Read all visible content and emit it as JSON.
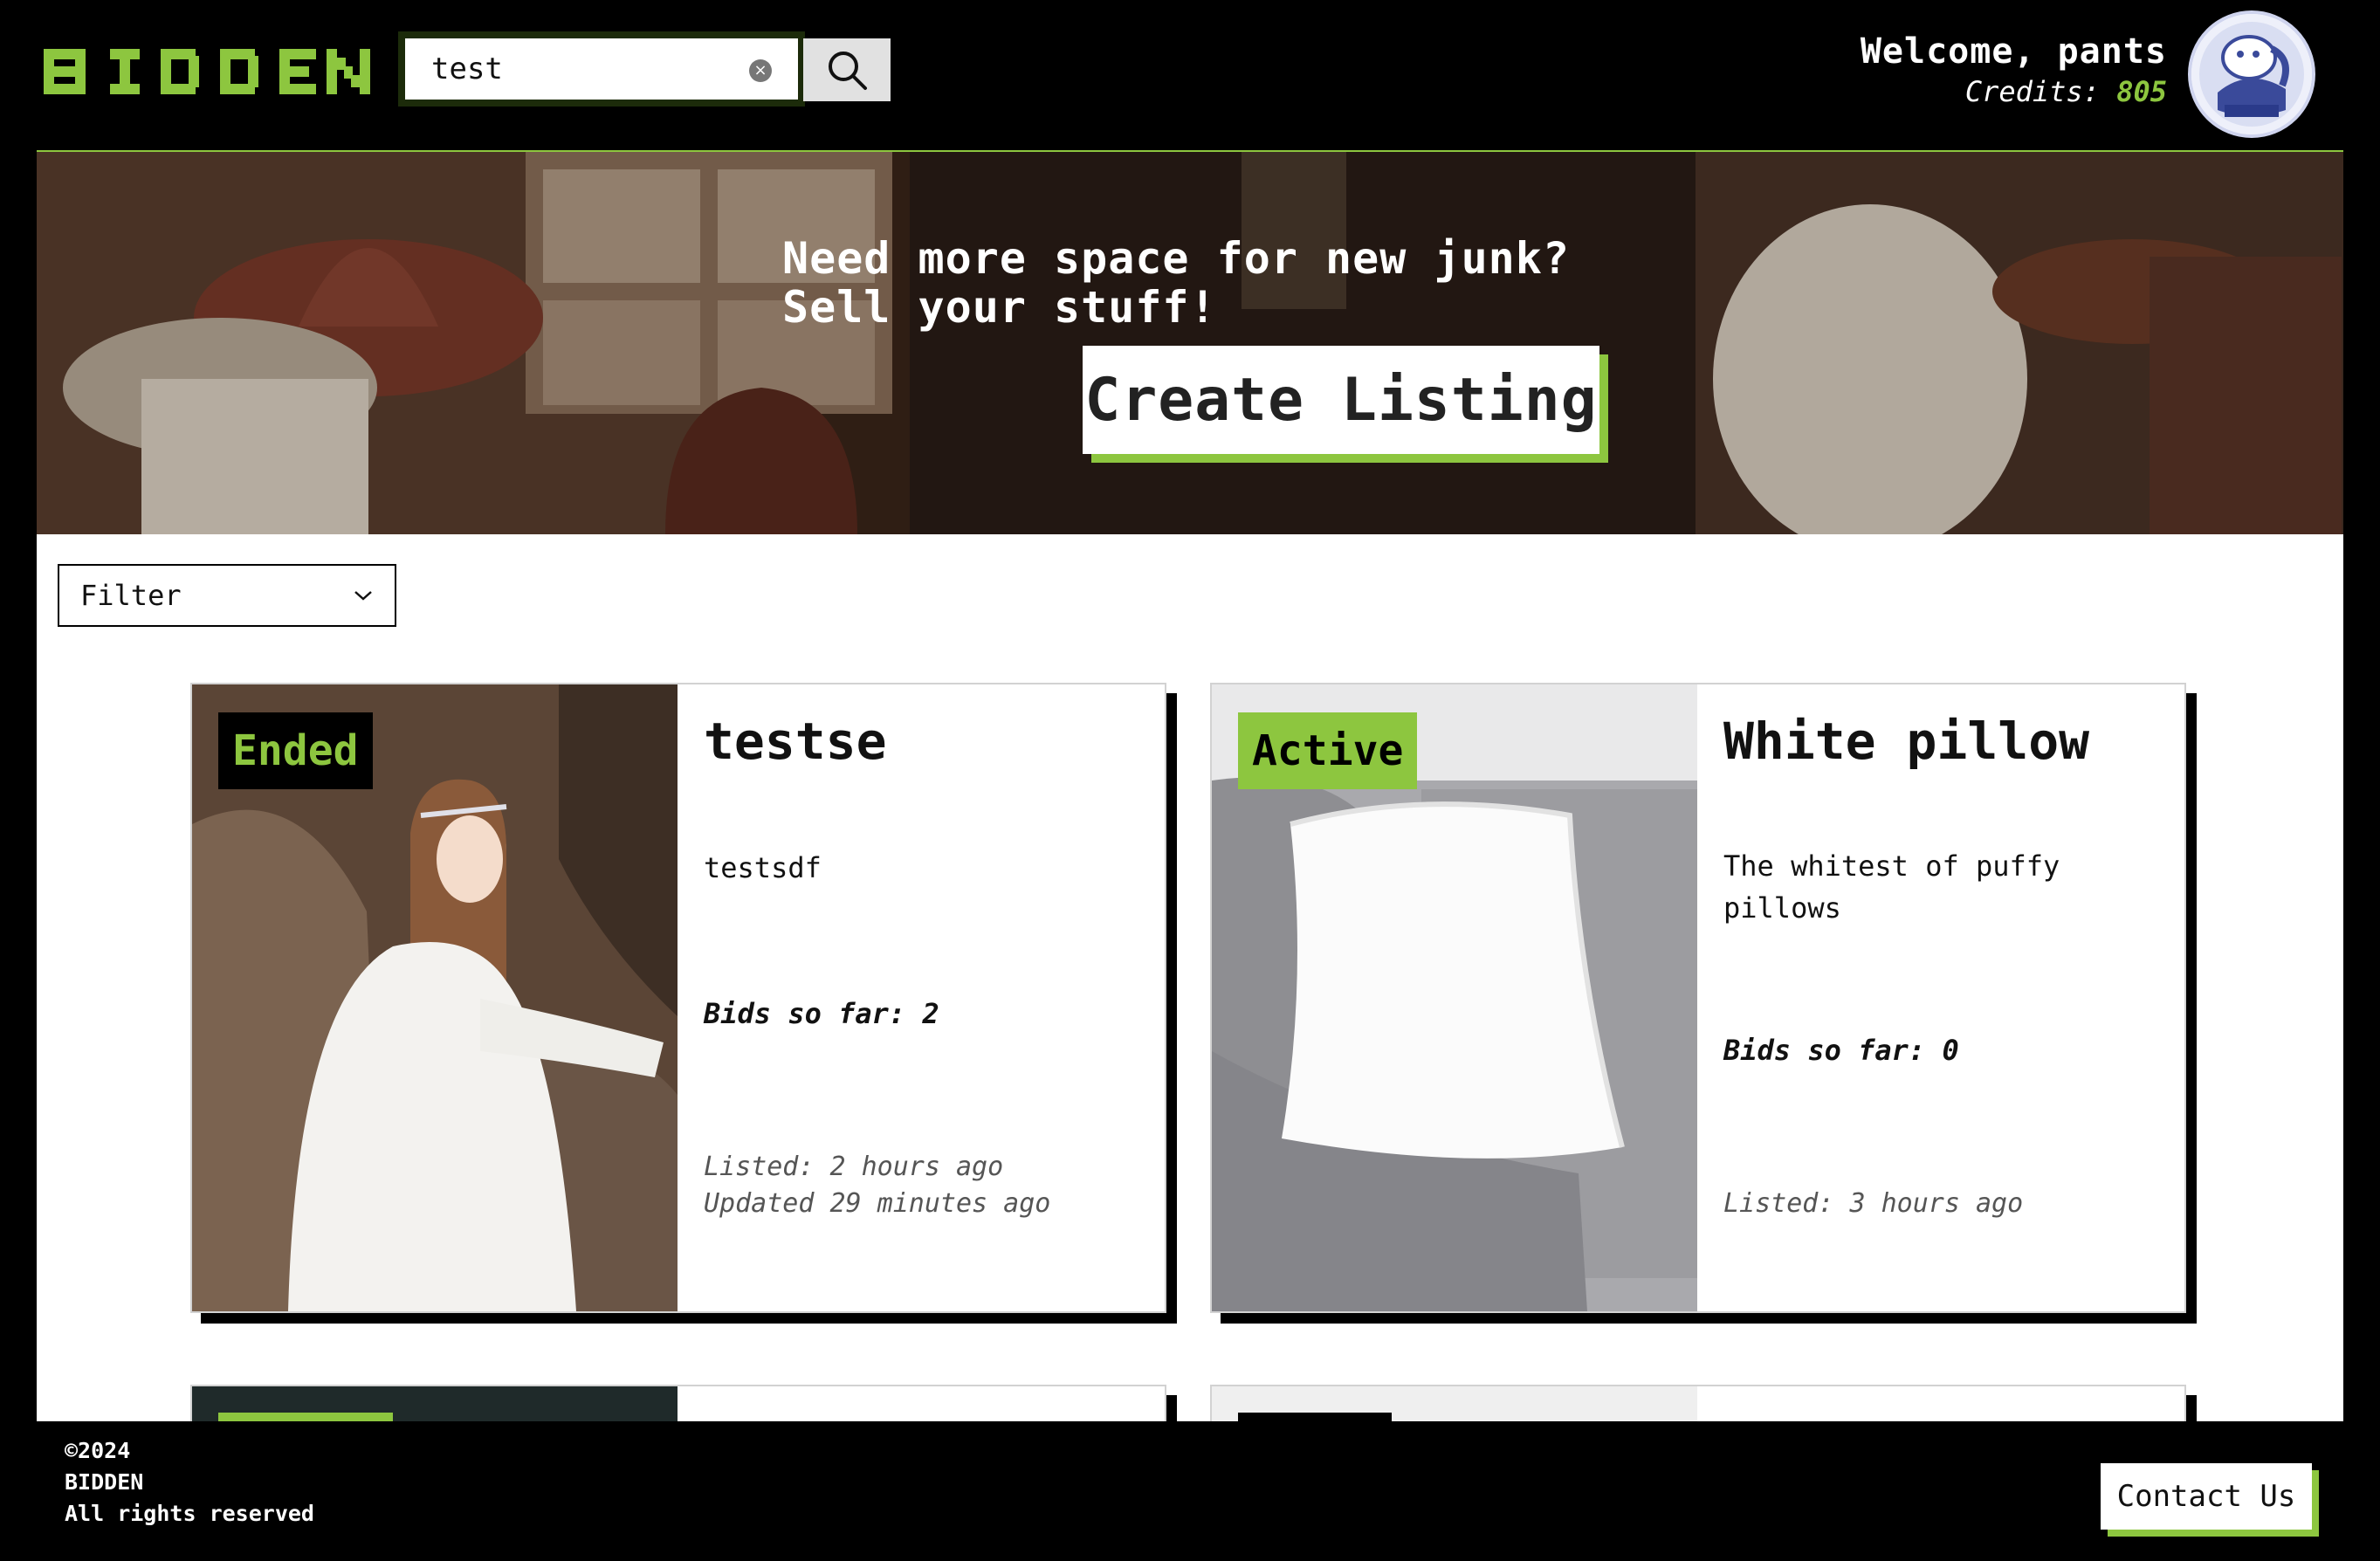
{
  "header": {
    "logo_text": "BIDDEN",
    "search": {
      "value": "test",
      "placeholder": ""
    },
    "welcome": "Welcome, pants",
    "credits_label": "Credits:",
    "credits_value": "805",
    "avatar_icon": "mascot-avatar-icon"
  },
  "hero": {
    "line1": "Need more space for new junk?",
    "line2": "Sell your stuff!",
    "cta_label": "Create Listing"
  },
  "filter": {
    "label": "Filter"
  },
  "listings": [
    {
      "status": "Ended",
      "title": "testse",
      "description": "testsdf",
      "bids": "Bids so far: 2",
      "listed": "Listed: 2 hours ago",
      "updated": "Updated 29 minutes ago"
    },
    {
      "status": "Active",
      "title": "White pillow",
      "description": "The whitest of puffy pillows",
      "bids": "Bids so far: 0",
      "listed": "Listed: 3 hours ago"
    }
  ],
  "footer": {
    "copyright": "©2024",
    "brand": "BIDDEN",
    "rights": "All rights reserved",
    "contact_label": "Contact Us"
  },
  "colors": {
    "accent": "#8dc63f",
    "background": "#000000",
    "surface": "#ffffff"
  }
}
